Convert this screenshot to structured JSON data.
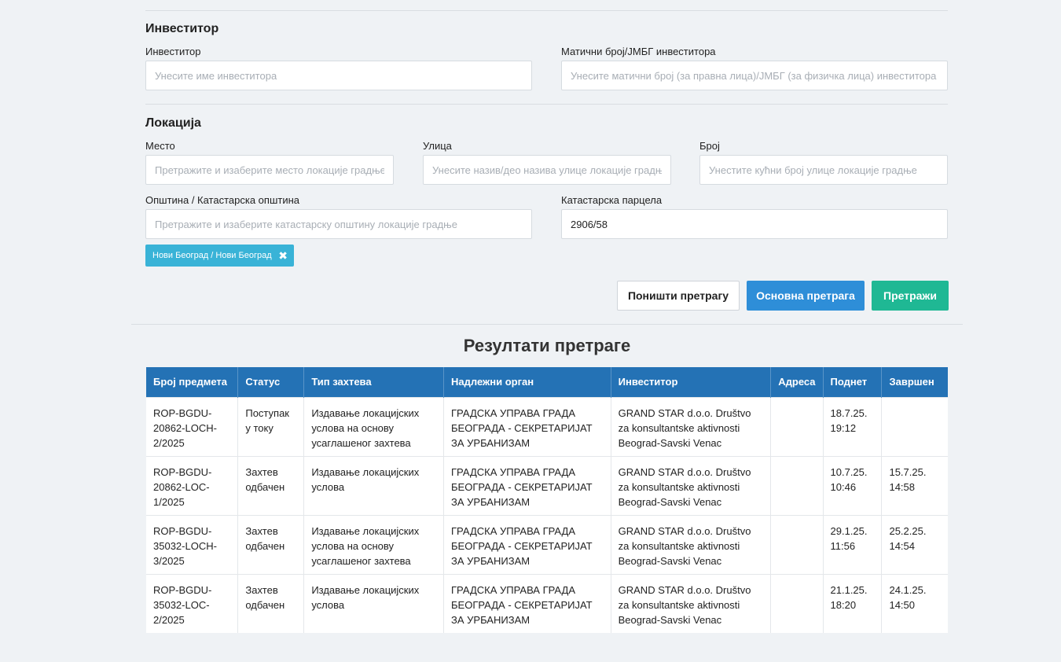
{
  "investor_section": {
    "title": "Инвеститор",
    "investor_label": "Инвеститор",
    "investor_placeholder": "Унесите име инвеститора",
    "id_label": "Матични број/ЈМБГ инвеститора",
    "id_placeholder": "Унесите матични број (за правна лица)/ЈМБГ (за физичка лица) инвеститора"
  },
  "location_section": {
    "title": "Локација",
    "place_label": "Место",
    "place_placeholder": "Претражите и изаберите место локације градње",
    "street_label": "Улица",
    "street_placeholder": "Унесите назив/део назива улице локације градње",
    "number_label": "Број",
    "number_placeholder": "Унестите кућни број улице локације градње",
    "municipality_label": "Општина / Катастарска општина",
    "municipality_placeholder": "Претражите и изаберите катастарску општину локације градње",
    "parcel_label": "Катастарска парцела",
    "parcel_value": "2906/58",
    "selected_tag": "Нови Београд / Нови Београд"
  },
  "buttons": {
    "reset": "Поништи претрагу",
    "basic": "Основна претрага",
    "search": "Претражи"
  },
  "results": {
    "title": "Резултати претраге",
    "columns": [
      "Број предмета",
      "Статус",
      "Тип захтева",
      "Надлежни орган",
      "Инвеститор",
      "Адреса",
      "Поднет",
      "Завршен"
    ],
    "rows": [
      {
        "case": "ROP-BGDU-20862-LOCH-2/2025",
        "status": "Поступак у току",
        "type": "Издавање локацијских услова на основу усаглашеног захтева",
        "authority": "ГРАДСКА УПРАВА ГРАДА БЕОГРАДА - СЕКРЕТАРИЈАТ ЗА УРБАНИЗАМ",
        "investor": "GRAND STAR d.o.o. Društvo za konsultantske aktivnosti Beograd-Savski Venac",
        "address": "",
        "submitted": "18.7.25. 19:12",
        "completed": ""
      },
      {
        "case": "ROP-BGDU-20862-LOC-1/2025",
        "status": "Захтев одбачен",
        "type": "Издавање локацијских услова",
        "authority": "ГРАДСКА УПРАВА ГРАДА БЕОГРАДА - СЕКРЕТАРИЈАТ ЗА УРБАНИЗАМ",
        "investor": "GRAND STAR d.o.o. Društvo za konsultantske aktivnosti Beograd-Savski Venac",
        "address": "",
        "submitted": "10.7.25. 10:46",
        "completed": "15.7.25. 14:58"
      },
      {
        "case": "ROP-BGDU-35032-LOCH-3/2025",
        "status": "Захтев одбачен",
        "type": "Издавање локацијских услова на основу усаглашеног захтева",
        "authority": "ГРАДСКА УПРАВА ГРАДА БЕОГРАДА - СЕКРЕТАРИЈАТ ЗА УРБАНИЗАМ",
        "investor": "GRAND STAR d.o.o. Društvo za konsultantske aktivnosti Beograd-Savski Venac",
        "address": "",
        "submitted": "29.1.25. 11:56",
        "completed": "25.2.25. 14:54"
      },
      {
        "case": "ROP-BGDU-35032-LOC-2/2025",
        "status": "Захтев одбачен",
        "type": "Издавање локацијских услова",
        "authority": "ГРАДСКА УПРАВА ГРАДА БЕОГРАДА - СЕКРЕТАРИЈАТ ЗА УРБАНИЗАМ",
        "investor": "GRAND STAR d.o.o. Društvo za konsultantske aktivnosti Beograd-Savski Venac",
        "address": "",
        "submitted": "21.1.25. 18:20",
        "completed": "24.1.25. 14:50"
      }
    ]
  },
  "icons": {
    "tag_remove": "close-icon"
  }
}
